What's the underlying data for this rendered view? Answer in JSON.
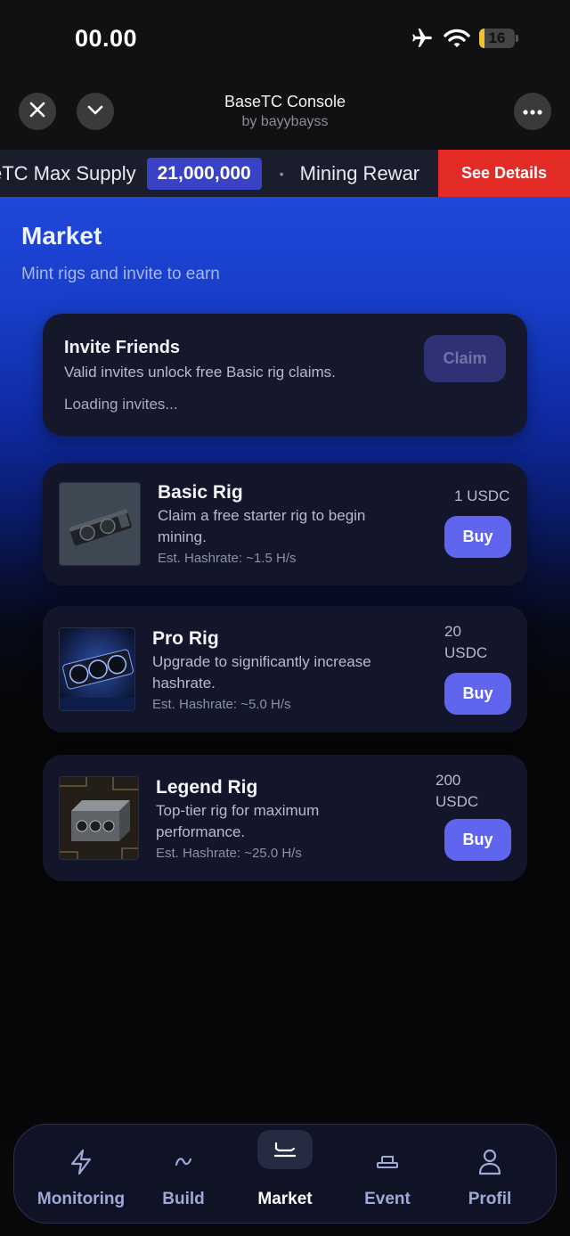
{
  "status_bar": {
    "time": "00.00",
    "battery_level": "16",
    "battery_fraction": 0.16
  },
  "header": {
    "title": "BaseTC Console",
    "subtitle": "by bayybayss"
  },
  "ticker": {
    "text_1": "eTC Max Supply",
    "badge_1": "21,000,000",
    "separator": "•",
    "text_2": "Mining Rewar",
    "cta": "See Details"
  },
  "market": {
    "title": "Market",
    "subtitle": "Mint rigs and invite to earn"
  },
  "invite": {
    "title": "Invite Friends",
    "description": "Valid invites unlock free Basic rig claims.",
    "status": "Loading invites...",
    "claim_label": "Claim"
  },
  "rigs": [
    {
      "name": "Basic Rig",
      "description": "Claim a free starter rig to begin mining.",
      "hashrate": "Est. Hashrate: ~1.5 H/s",
      "price": "1 USDC",
      "buy_label": "Buy"
    },
    {
      "name": "Pro Rig",
      "description": "Upgrade to significantly increase hashrate.",
      "hashrate": "Est. Hashrate: ~5.0 H/s",
      "price": "20 USDC",
      "buy_label": "Buy"
    },
    {
      "name": "Legend Rig",
      "description": "Top-tier rig for maximum performance.",
      "hashrate": "Est. Hashrate: ~25.0 H/s",
      "price": "200 USDC",
      "buy_label": "Buy"
    }
  ],
  "nav": {
    "items": [
      {
        "label": "Monitoring",
        "icon": "lightning-icon"
      },
      {
        "label": "Build",
        "icon": "tilde-icon"
      },
      {
        "label": "Market",
        "icon": "tray-icon",
        "active": true
      },
      {
        "label": "Event",
        "icon": "podium-icon"
      },
      {
        "label": "Profil",
        "icon": "user-icon"
      }
    ]
  },
  "colors": {
    "accent": "#6065f0",
    "cta_red": "#e42c27",
    "badge": "#3941c4",
    "card": "#13162a"
  }
}
